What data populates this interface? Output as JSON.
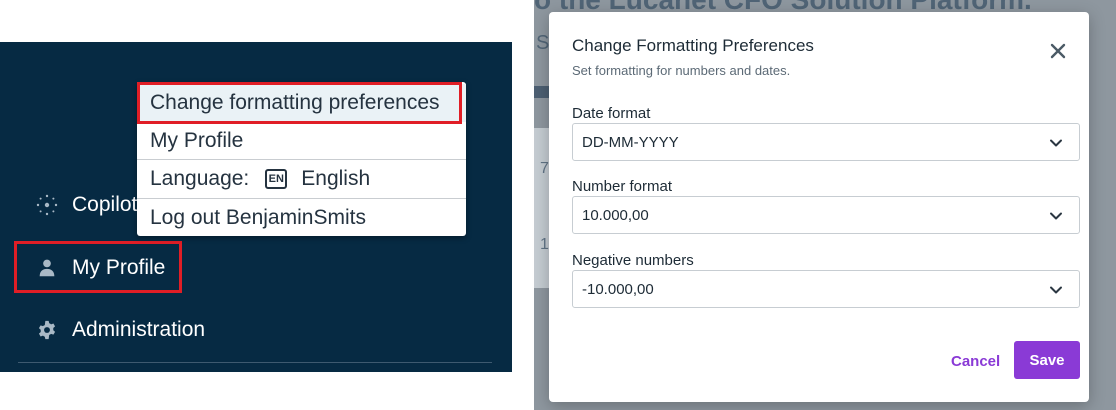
{
  "sidebar": {
    "items": [
      {
        "label": "Copilot",
        "icon": "sparkle-icon"
      },
      {
        "label": "My Profile",
        "icon": "person-icon"
      },
      {
        "label": "Administration",
        "icon": "gear-icon"
      }
    ]
  },
  "user_menu": {
    "items": [
      {
        "label": "Change formatting preferences"
      },
      {
        "label": "My Profile"
      },
      {
        "label": "Language:",
        "badge": "EN",
        "value": "English"
      },
      {
        "label": "Log out BenjaminSmits"
      }
    ]
  },
  "background": {
    "heading": "o the Lucanet CFO Solution Platform.",
    "fragment": "S",
    "numbers": [
      "7",
      "1"
    ]
  },
  "dialog": {
    "title": "Change Formatting Preferences",
    "subtitle": "Set formatting for numbers and dates.",
    "fields": [
      {
        "label": "Date format",
        "value": "DD-MM-YYYY"
      },
      {
        "label": "Number format",
        "value": "10.000,00"
      },
      {
        "label": "Negative numbers",
        "value": "-10.000,00"
      }
    ],
    "cancel_label": "Cancel",
    "save_label": "Save"
  },
  "colors": {
    "sidebar_bg": "#062a43",
    "highlight_border": "#e01e26",
    "accent": "#8a3ad6"
  }
}
